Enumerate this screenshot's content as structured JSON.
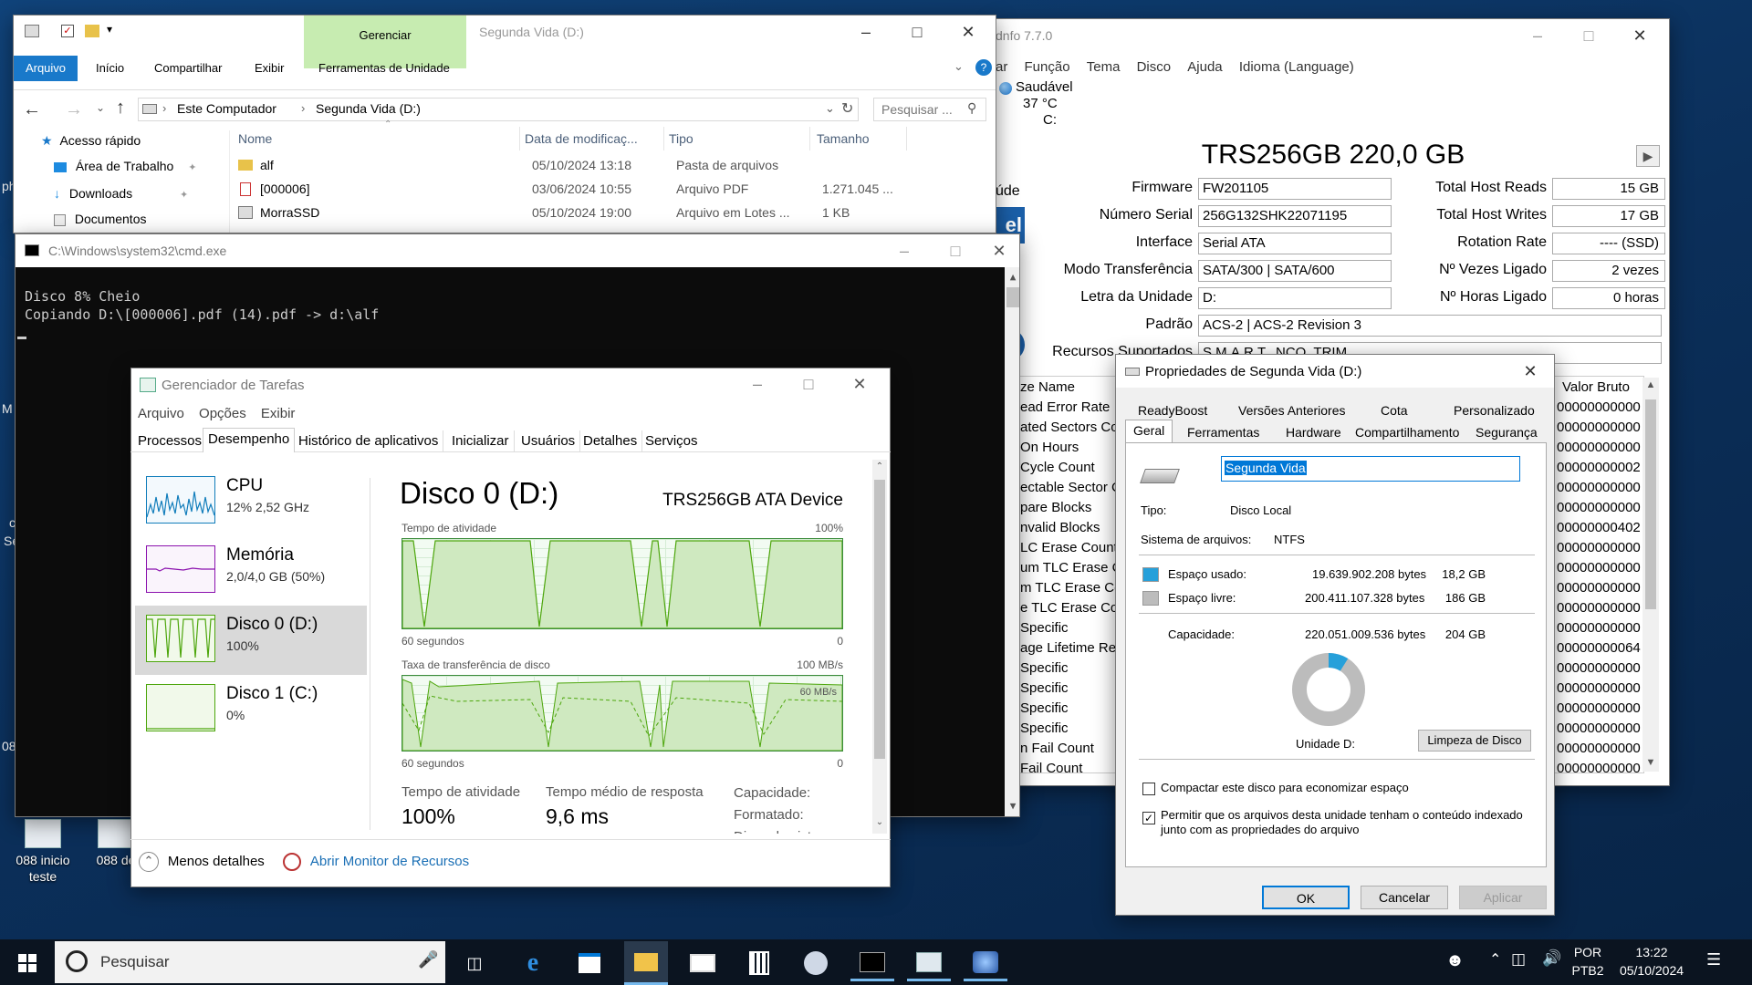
{
  "desktop": {
    "icons": [
      {
        "label": "088 inicio teste"
      },
      {
        "label": "088 de"
      }
    ],
    "edge_texts": [
      "ph",
      "M",
      "c",
      "Se",
      "08"
    ]
  },
  "explorer": {
    "title": "Segunda Vida (D:)",
    "contextual_group": "Gerenciar",
    "ribbon_tabs": [
      "Arquivo",
      "Início",
      "Compartilhar",
      "Exibir",
      "Ferramentas de Unidade"
    ],
    "address": [
      "Este Computador",
      "Segunda Vida (D:)"
    ],
    "search_placeholder": "Pesquisar ...",
    "nav": [
      "Acesso rápido",
      "Área de Trabalho",
      "Downloads",
      "Documentos"
    ],
    "columns": [
      "Nome",
      "Data de modificaç...",
      "Tipo",
      "Tamanho"
    ],
    "rows": [
      {
        "name": "alf",
        "date": "05/10/2024 13:18",
        "type": "Pasta de arquivos",
        "size": ""
      },
      {
        "name": "[000006]",
        "date": "03/06/2024 10:55",
        "type": "Arquivo PDF",
        "size": "1.271.045 ..."
      },
      {
        "name": "MorraSSD",
        "date": "05/10/2024 19:00",
        "type": "Arquivo em Lotes ...",
        "size": "1 KB"
      }
    ]
  },
  "crystal": {
    "title": "dnfo 7.7.0",
    "menu": [
      "ar",
      "Função",
      "Tema",
      "Disco",
      "Ajuda",
      "Idioma (Language)"
    ],
    "status_text": "Saudável",
    "temp": "37 °C",
    "drive_letter": "C:",
    "model": "TRS256GB 220,0 GB",
    "side_label_cut": "úde",
    "side_logo": "el",
    "left_fields": [
      {
        "label": "Firmware",
        "value": "FW201105"
      },
      {
        "label": "Número Serial",
        "value": "256G132SHK22071195"
      },
      {
        "label": "Interface",
        "value": "Serial ATA"
      },
      {
        "label": "Modo Transferência",
        "value": "SATA/300 | SATA/600"
      },
      {
        "label": "Letra da Unidade",
        "value": "D:"
      },
      {
        "label": "Padrão",
        "value": "ACS-2 | ACS-2 Revision 3"
      },
      {
        "label": "Recursos Suportados",
        "value": "S.M.A.R.T., NCQ, TRIM"
      }
    ],
    "right_fields": [
      {
        "label": "Total Host Reads",
        "value": "15 GB"
      },
      {
        "label": "Total Host Writes",
        "value": "17 GB"
      },
      {
        "label": "Rotation Rate",
        "value": "---- (SSD)"
      },
      {
        "label": "Nº Vezes Ligado",
        "value": "2 vezes"
      },
      {
        "label": "Nº Horas Ligado",
        "value": "0 horas"
      }
    ],
    "attr_header_name": "ze Name",
    "attr_header_raw": "Valor Bruto",
    "attrs": [
      {
        "name": "ead Error Rate",
        "raw": "00000000000"
      },
      {
        "name": "ated Sectors Co",
        "raw": "00000000000"
      },
      {
        "name": "On Hours",
        "raw": "00000000000"
      },
      {
        "name": "Cycle Count",
        "raw": "00000000002"
      },
      {
        "name": "ectable Sector C",
        "raw": "00000000000"
      },
      {
        "name": "pare Blocks",
        "raw": "00000000000"
      },
      {
        "name": "nvalid Blocks",
        "raw": "00000000402"
      },
      {
        "name": "LC Erase Count",
        "raw": "00000000000"
      },
      {
        "name": "um TLC Erase C",
        "raw": "00000000000"
      },
      {
        "name": "m TLC Erase Co",
        "raw": "00000000000"
      },
      {
        "name": "e TLC Erase Co",
        "raw": "00000000000"
      },
      {
        "name": "Specific",
        "raw": "00000000000"
      },
      {
        "name": "age Lifetime Re",
        "raw": "00000000064"
      },
      {
        "name": "Specific",
        "raw": "00000000000"
      },
      {
        "name": "Specific",
        "raw": "00000000000"
      },
      {
        "name": "Specific",
        "raw": "00000000000"
      },
      {
        "name": "Specific",
        "raw": "00000000000"
      },
      {
        "name": "n Fail Count",
        "raw": "00000000000"
      },
      {
        "name": "Fail Count",
        "raw": "00000000000"
      }
    ]
  },
  "cmd": {
    "title": "C:\\Windows\\system32\\cmd.exe",
    "lines": [
      "Disco 8% Cheio",
      "Copiando D:\\[000006].pdf (14).pdf -> d:\\alf"
    ]
  },
  "taskmgr": {
    "title": "Gerenciador de Tarefas",
    "menu": [
      "Arquivo",
      "Opções",
      "Exibir"
    ],
    "tabs": [
      "Processos",
      "Desempenho",
      "Histórico de aplicativos",
      "Inicializar",
      "Usuários",
      "Detalhes",
      "Serviços"
    ],
    "side": [
      {
        "name": "CPU",
        "detail": "12% 2,52 GHz"
      },
      {
        "name": "Memória",
        "detail": "2,0/4,0 GB (50%)"
      },
      {
        "name": "Disco 0 (D:)",
        "detail": "100%"
      },
      {
        "name": "Disco 1 (C:)",
        "detail": "0%"
      }
    ],
    "heading": "Disco 0 (D:)",
    "device": "TRS256GB ATA Device",
    "graph1_label": "Tempo de atividade",
    "graph1_max": "100%",
    "graph1_time": "60 segundos",
    "graph1_min": "0",
    "graph2_label": "Taxa de transferência de disco",
    "graph2_max": "100 MB/s",
    "graph2_mark": "60 MB/s",
    "graph2_time": "60 segundos",
    "graph2_min": "0",
    "stats": [
      {
        "label": "Tempo de atividade",
        "value": "100%"
      },
      {
        "label": "Tempo médio de resposta",
        "value": "9,6 ms"
      }
    ],
    "right_labels": [
      "Capacidade:",
      "Formatado:",
      "Disco do sistema:"
    ],
    "fewer_details": "Menos detalhes",
    "resource_monitor": "Abrir Monitor de Recursos"
  },
  "props": {
    "title": "Propriedades de Segunda Vida (D:)",
    "tabs_row1": [
      "ReadyBoost",
      "Versões Anteriores",
      "Cota",
      "Personalizado"
    ],
    "tabs_row2": [
      "Geral",
      "Ferramentas",
      "Hardware",
      "Compartilhamento",
      "Segurança"
    ],
    "name_value": "Segunda Vida",
    "type_label": "Tipo:",
    "type_value": "Disco Local",
    "fs_label": "Sistema de arquivos:",
    "fs_value": "NTFS",
    "used_label": "Espaço usado:",
    "used_bytes": "19.639.902.208 bytes",
    "used_gb": "18,2 GB",
    "free_label": "Espaço livre:",
    "free_bytes": "200.411.107.328 bytes",
    "free_gb": "186 GB",
    "cap_label": "Capacidade:",
    "cap_bytes": "220.051.009.536 bytes",
    "cap_gb": "204 GB",
    "used_fraction": 0.089,
    "drive_label": "Unidade D:",
    "cleanup": "Limpeza de Disco",
    "compress": "Compactar este disco para economizar espaço",
    "index": "Permitir que os arquivos desta unidade tenham o conteúdo indexado junto com as propriedades do arquivo",
    "ok": "OK",
    "cancel": "Cancelar",
    "apply": "Aplicar",
    "used_color": "#26a0da",
    "free_color": "#bcbcbc"
  },
  "taskbar": {
    "search": "Pesquisar",
    "lang1": "POR",
    "lang2": "PTB2",
    "time": "13:22",
    "date": "05/10/2024"
  }
}
